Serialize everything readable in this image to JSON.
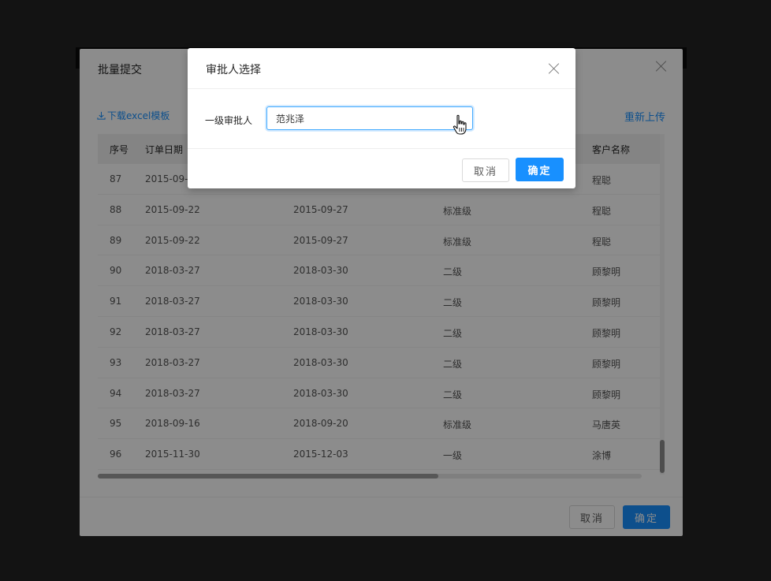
{
  "main_dialog": {
    "title": "批量提交",
    "download_label": "下载excel模板",
    "reupload_label": "重新上传",
    "columns": [
      "序号",
      "订单日期",
      "",
      "",
      "客户名称"
    ],
    "rows": [
      [
        "87",
        "2015-09-",
        "",
        "",
        "程聪"
      ],
      [
        "88",
        "2015-09-22",
        "2015-09-27",
        "标准级",
        "程聪"
      ],
      [
        "89",
        "2015-09-22",
        "2015-09-27",
        "标准级",
        "程聪"
      ],
      [
        "90",
        "2018-03-27",
        "2018-03-30",
        "二级",
        "顾黎明"
      ],
      [
        "91",
        "2018-03-27",
        "2018-03-30",
        "二级",
        "顾黎明"
      ],
      [
        "92",
        "2018-03-27",
        "2018-03-30",
        "二级",
        "顾黎明"
      ],
      [
        "93",
        "2018-03-27",
        "2018-03-30",
        "二级",
        "顾黎明"
      ],
      [
        "94",
        "2018-03-27",
        "2018-03-30",
        "二级",
        "顾黎明"
      ],
      [
        "95",
        "2018-09-16",
        "2018-09-20",
        "标准级",
        "马唐英"
      ],
      [
        "96",
        "2015-11-30",
        "2015-12-03",
        "一级",
        "涂博"
      ]
    ],
    "cancel_label": "取消",
    "ok_label": "确定"
  },
  "approver_dialog": {
    "title": "审批人选择",
    "field_label": "一级审批人",
    "field_value": "范兆泽",
    "cancel_label": "取消",
    "ok_label": "确定"
  },
  "colors": {
    "primary": "#1890ff",
    "backdrop": "#232323"
  }
}
